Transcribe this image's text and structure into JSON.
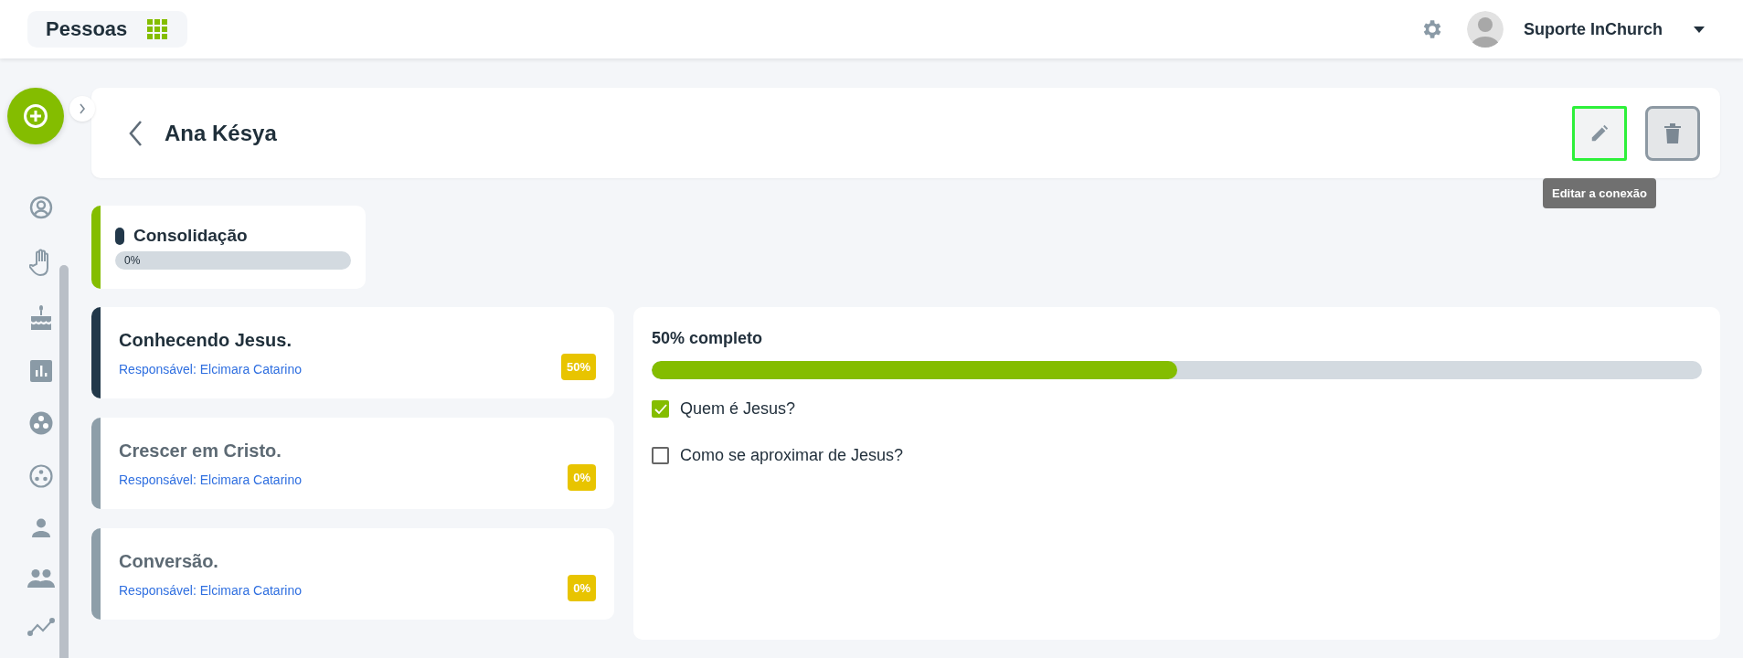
{
  "app_bar": {
    "title": "Pessoas",
    "user_name": "Suporte InChurch"
  },
  "header": {
    "title": "Ana Késya",
    "edit_focused": true,
    "tooltip": "Editar a conexão"
  },
  "stage": {
    "name": "Consolidação",
    "level": 0,
    "reading": "0%"
  },
  "steps": [
    {
      "title": "Conhecendo Jesus.",
      "responsible": "Responsável: Elcimara Catarino",
      "badge": "50%",
      "selected": true
    },
    {
      "title": "Crescer em Cristo.",
      "responsible": "Responsável: Elcimara Catarino",
      "badge": "0%",
      "selected": false
    },
    {
      "title": "Conversão.",
      "responsible": "Responsável: Elcimara Catarino",
      "badge": "0%",
      "selected": false
    }
  ],
  "detail": {
    "progress_label": "50% completo",
    "level": 0.5,
    "tasks": [
      {
        "label": "Quem é Jesus?",
        "checked": true
      },
      {
        "label": "Como se aproximar de Jesus?",
        "checked": false
      }
    ]
  }
}
